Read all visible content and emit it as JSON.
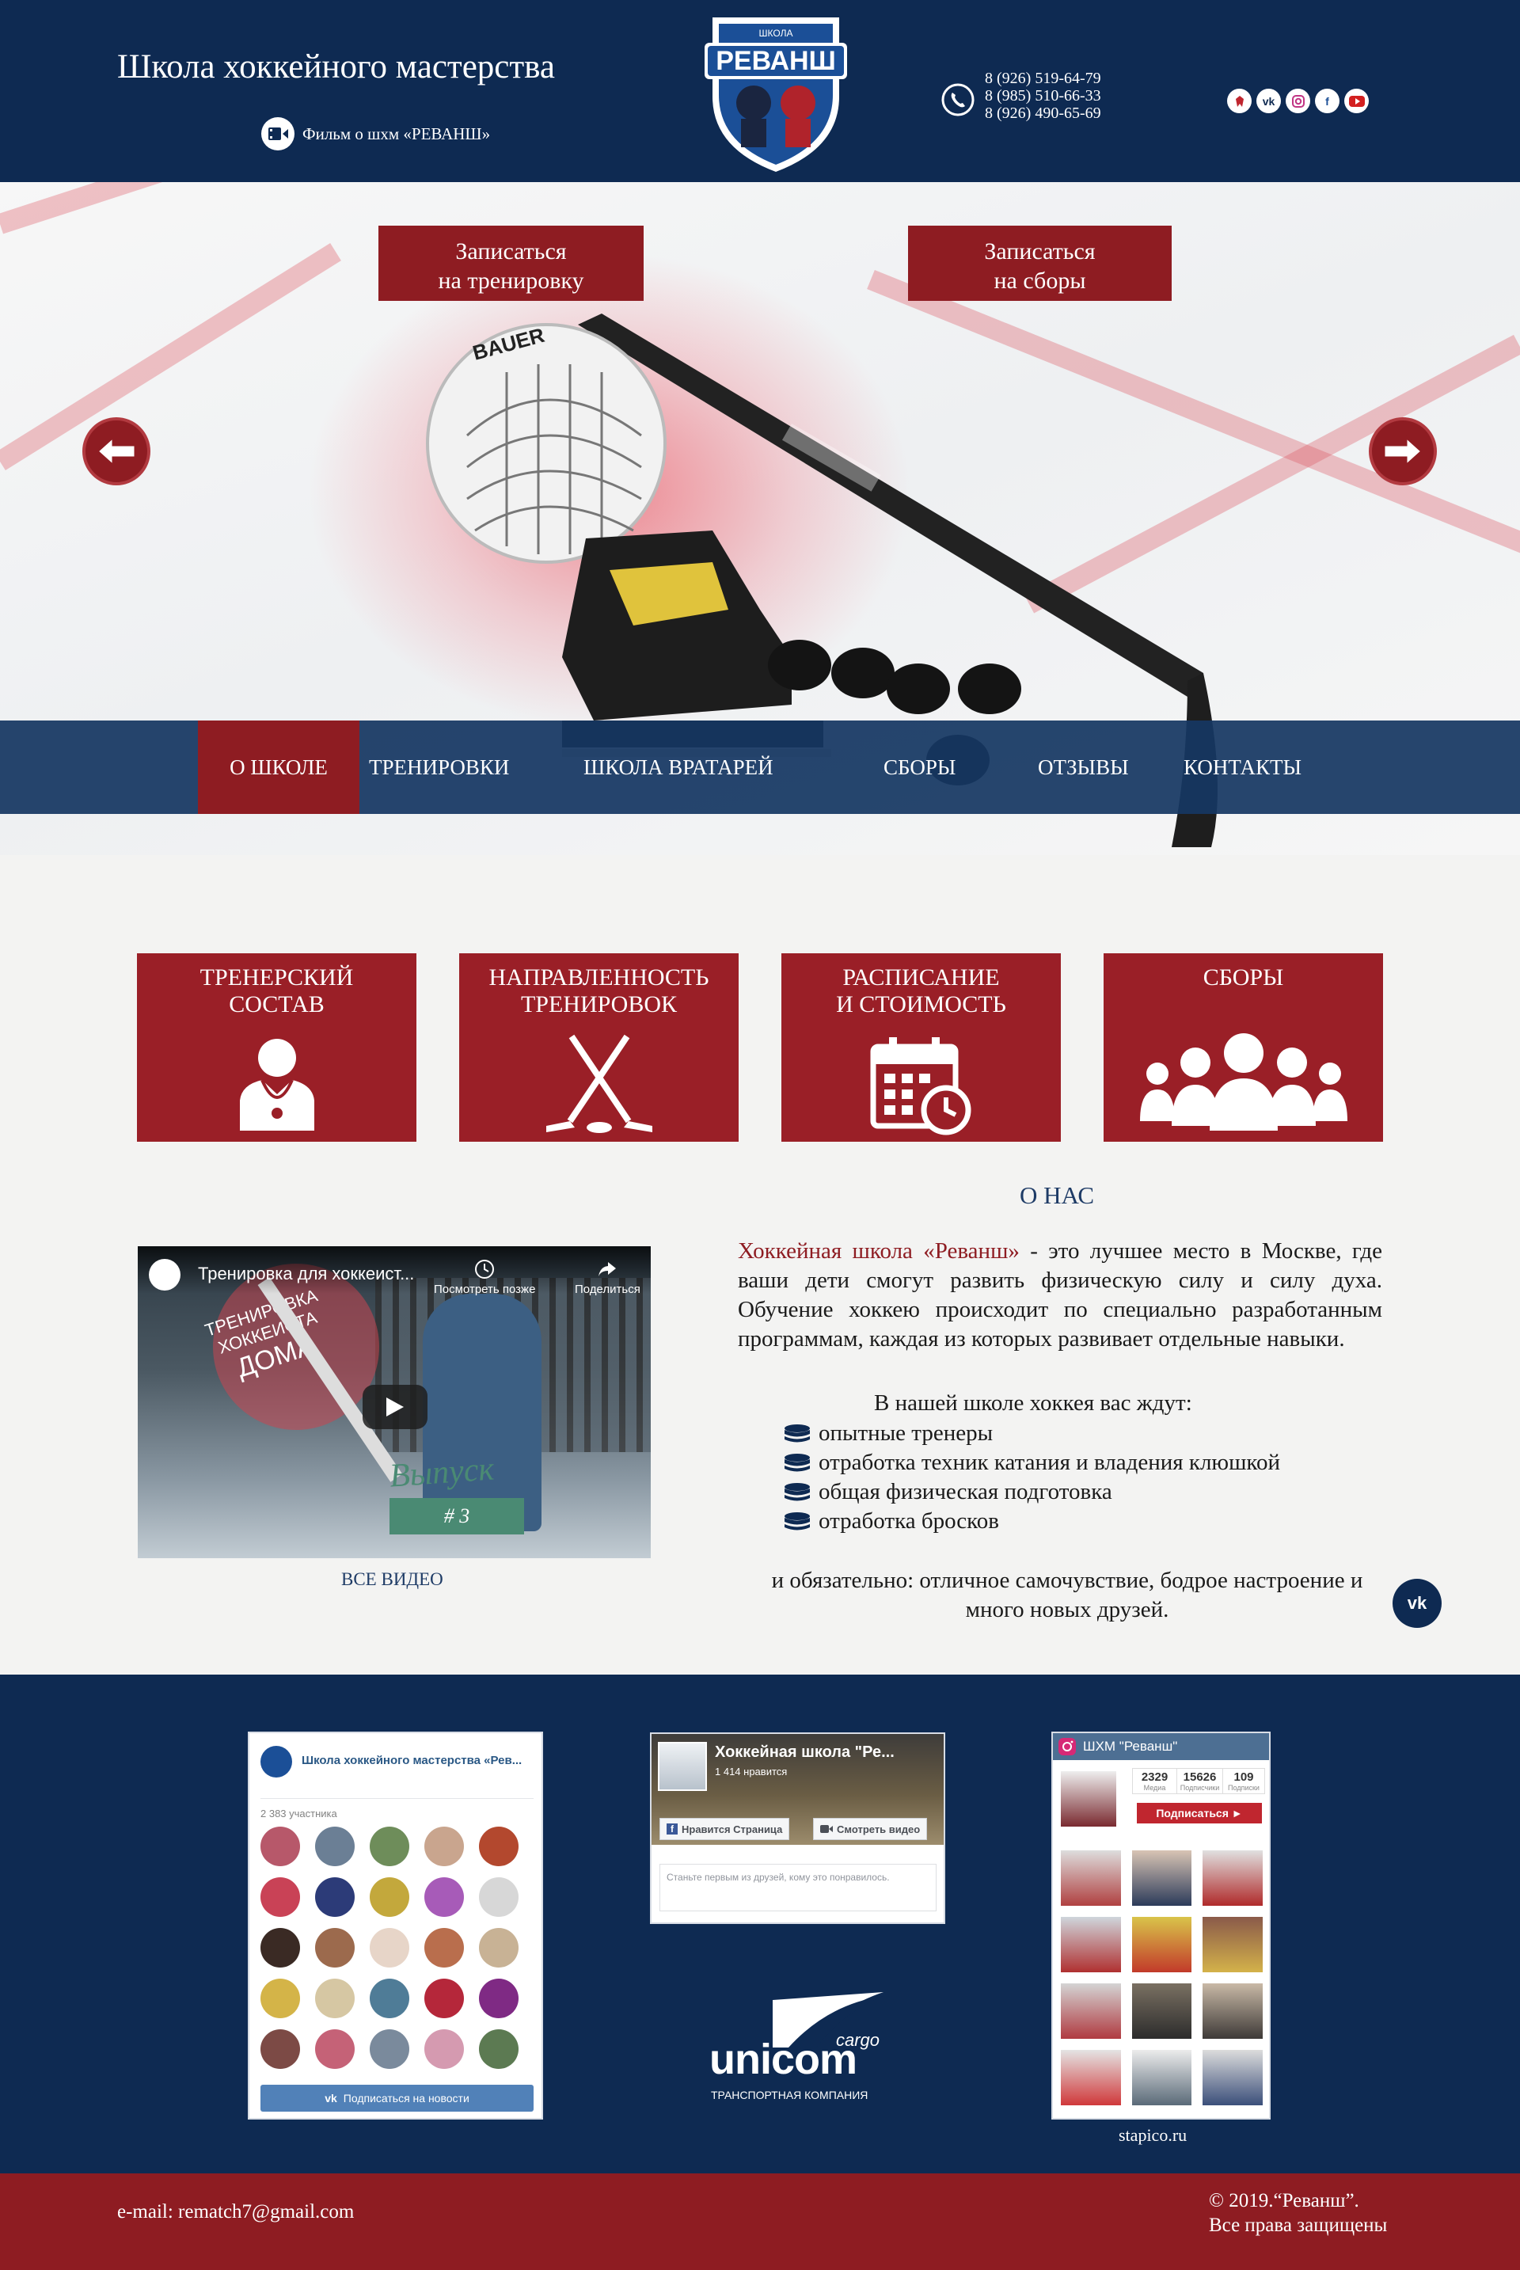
{
  "header": {
    "title": "Школа хоккейного мастерства",
    "film_link": "Фильм о шхм «РЕВАНШ»",
    "logo_text": "РЕВАНШ",
    "logo_top_text": "ШКОЛА",
    "phones": [
      "8 (926) 519-64-79",
      "8 (985) 510-66-33",
      "8 (926) 490-65-69"
    ],
    "socials": [
      "telegram-icon",
      "vk-icon",
      "instagram-icon",
      "facebook-icon",
      "youtube-icon"
    ]
  },
  "hero": {
    "cta_training": [
      "Записаться",
      "на тренировку"
    ],
    "cta_camps": [
      "Записаться",
      "на сборы"
    ],
    "helmet_brand": "BAUER"
  },
  "nav": [
    "О ШКОЛЕ",
    "ТРЕНИРОВКИ",
    "ШКОЛА ВРАТАРЕЙ",
    "СБОРЫ",
    "ОТЗЫВЫ",
    "КОНТАКТЫ"
  ],
  "tiles": [
    {
      "label": [
        "ТРЕНЕРСКИЙ",
        "СОСТАВ"
      ],
      "icon": "coach-icon"
    },
    {
      "label": [
        "НАПРАВЛЕННОСТЬ",
        "ТРЕНИРОВОК"
      ],
      "icon": "hockey-sticks-icon"
    },
    {
      "label": [
        "РАСПИСАНИЕ",
        "И СТОИМОСТЬ"
      ],
      "icon": "calendar-clock-icon"
    },
    {
      "label": [
        "СБОРЫ"
      ],
      "icon": "group-icon"
    }
  ],
  "about": {
    "title": "О НАС",
    "school_name": "Хоккейная школа «Реванш»",
    "intro_rest": " - это лучшее место в Москве, где ваши дети смогут развить физическую силу и силу духа. Обучение хоккею происходит по специально разработанным программам, каждая из которых развивает отдельные навыки.",
    "await": "В нашей школе хоккея вас ждут:",
    "bullets": [
      "опытные тренеры",
      "отработка техник катания и владения клюшкой",
      "общая физическая подготовка",
      "отработка бросков"
    ],
    "finale": "и обязательно: отличное самочувствие, бодрое настроение и много новых друзей."
  },
  "video": {
    "title": "Тренировка для хоккеист...",
    "watch_later": "Посмотреть позже",
    "share": "Поделиться",
    "overlay_top": [
      "ТРЕНИРОВКА",
      "ХОККЕИСТА",
      "ДОМА"
    ],
    "overlay_issue": "Выпуск",
    "overlay_number": "# 3",
    "all_videos": "ВСЕ ВИДЕО"
  },
  "vk_widget": {
    "title": "Школа хоккейного мастерства «Рев...",
    "members": "2 383 участника",
    "subscribe": "Подписаться на новости"
  },
  "fb_widget": {
    "title": "Хоккейная школа \"Ре...",
    "likes": "1 414 нравится",
    "like_btn": "Нравится Страница",
    "video_btn": "Смотреть видео",
    "note": "Станьте первым из друзей, кому это понравилось."
  },
  "ig_widget": {
    "title": "ШХМ \"Реванш\"",
    "stats": [
      {
        "value": "2329",
        "label": "Медиа"
      },
      {
        "value": "15626",
        "label": "Подписчики"
      },
      {
        "value": "109",
        "label": "Подписки"
      }
    ],
    "subscribe": "Подписаться ►",
    "credit": "stapico.ru"
  },
  "partner": {
    "name": "unicom",
    "tag": "cargo",
    "subtitle": "ТРАНСПОРТНАЯ КОМПАНИЯ"
  },
  "footer": {
    "email": "e-mail: rematch7@gmail.com",
    "copyright": [
      "© 2019.“Реванш”.",
      "Все права защищены"
    ]
  },
  "colors": {
    "navy": "#0e2a52",
    "crimson": "#8e1c22",
    "tile": "#9a1f27",
    "background": "#f3f3f2"
  }
}
